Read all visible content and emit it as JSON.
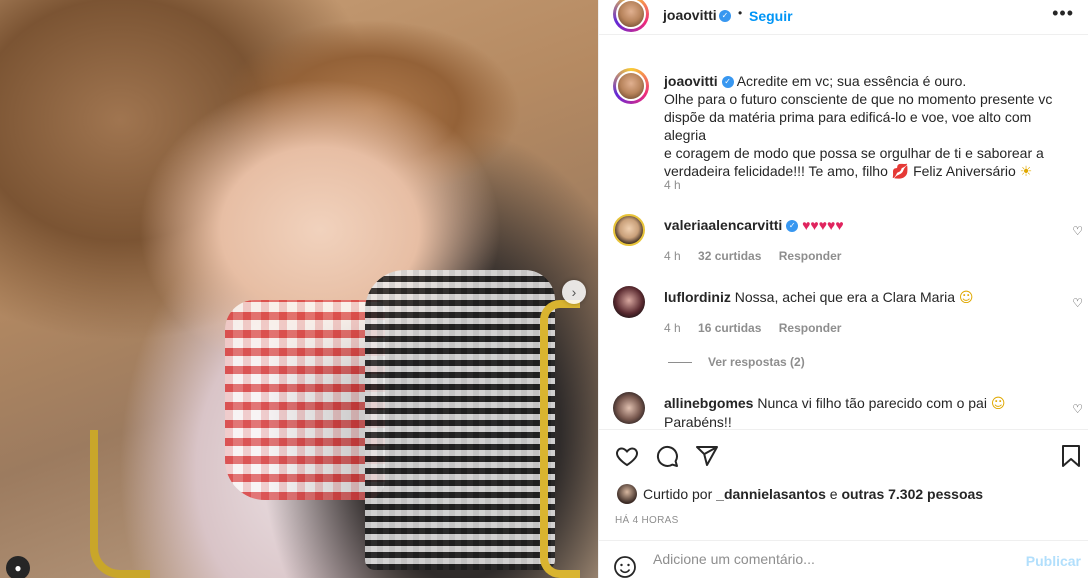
{
  "post": {
    "username": "joaovitti",
    "follow_label": "Seguir",
    "more_label": "•••",
    "separator": "•"
  },
  "caption": {
    "username": "joaovitti",
    "line1": "Acredite em vc; sua essência é ouro.",
    "line2": "Olhe para o futuro consciente de que no momento presente vc",
    "line3": "dispõe da matéria prima para edificá-lo e voe, voe alto com alegria",
    "line4": "e coragem de modo que possa se orgulhar de ti e saborear a",
    "line5": "verdadeira felicidade!!! Te amo, filho",
    "line5b": "Feliz Aniversário",
    "time": "4 h"
  },
  "comments": [
    {
      "username": "valeriaalencarvitti",
      "text": "♥♥♥♥♥",
      "time": "4 h",
      "likes": "32 curtidas",
      "reply": "Responder"
    },
    {
      "username": "luflordiniz",
      "text": "Nossa, achei que era a Clara Maria",
      "time": "4 h",
      "likes": "16 curtidas",
      "reply": "Responder"
    },
    {
      "username": "allinebgomes",
      "text": "Nunca vi filho tão parecido com o pai",
      "text2": "Parabéns!!"
    }
  ],
  "view_replies": "Ver respostas (2)",
  "likes": {
    "prefix": "Curtido por",
    "user": "_dannielasantos",
    "connector": "e",
    "others": "outras 7.302 pessoas"
  },
  "date": "HÁ 4 HORAS",
  "add_comment": {
    "placeholder": "Adicione um comentário...",
    "publish_label": "Publicar"
  },
  "icons": {
    "next": "chevron-right-icon",
    "heart": "heart-icon",
    "comment": "comment-icon",
    "share": "paper-plane-icon",
    "save": "bookmark-icon",
    "emoji": "smiley-icon"
  }
}
